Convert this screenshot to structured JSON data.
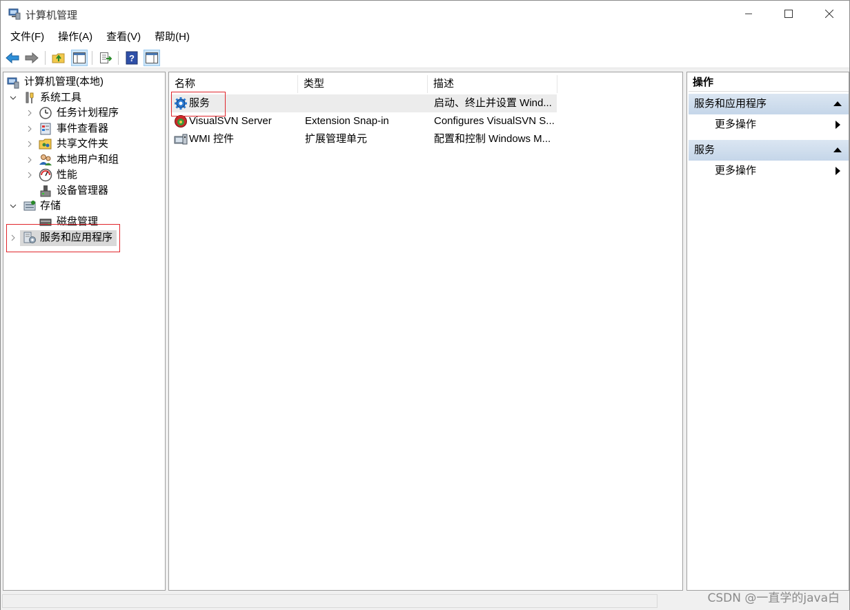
{
  "window": {
    "title": "计算机管理"
  },
  "menu": [
    "文件(F)",
    "操作(A)",
    "查看(V)",
    "帮助(H)"
  ],
  "toolbar": {
    "icons": [
      "back-icon",
      "forward-icon",
      "up-folder-icon",
      "show-hide-tree-icon",
      "export-list-icon",
      "help-icon",
      "show-hide-action-pane-icon"
    ]
  },
  "tree": {
    "root": "计算机管理(本地)",
    "system_tools": "系统工具",
    "task_scheduler": "任务计划程序",
    "event_viewer": "事件查看器",
    "shared_folders": "共享文件夹",
    "local_users": "本地用户和组",
    "performance": "性能",
    "device_manager": "设备管理器",
    "storage": "存储",
    "disk_management": "磁盘管理",
    "services_apps": "服务和应用程序",
    "selected": "服务和应用程序"
  },
  "list": {
    "columns": [
      "名称",
      "类型",
      "描述"
    ],
    "rows": [
      {
        "name": "服务",
        "type": "",
        "desc": "启动、终止并设置 Wind...",
        "icon": "services-gear-icon"
      },
      {
        "name": "VisualSVN Server",
        "type": "Extension Snap-in",
        "desc": "Configures VisualSVN S...",
        "icon": "visualsvn-icon"
      },
      {
        "name": "WMI 控件",
        "type": "扩展管理单元",
        "desc": "配置和控制 Windows M...",
        "icon": "wmi-control-icon"
      }
    ]
  },
  "actions": {
    "header": "操作",
    "section1": {
      "title": "服务和应用程序",
      "item": "更多操作"
    },
    "section2": {
      "title": "服务",
      "item": "更多操作"
    }
  },
  "watermark": "CSDN @一直学的java白",
  "colors": {
    "highlight_box": "#e0242a",
    "action_section": "#c5d6e9",
    "selection": "#d9d9d9"
  }
}
